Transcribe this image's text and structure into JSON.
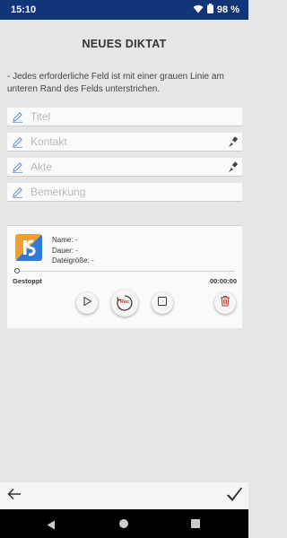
{
  "status": {
    "time": "15:10",
    "battery": "98 %"
  },
  "page": {
    "title": "NEUES DIKTAT",
    "hint": "- Jedes erforderliche Feld ist mit einer grauen Linie am unteren Rand des Felds unterstrichen."
  },
  "fields": [
    {
      "placeholder": "Titel"
    },
    {
      "placeholder": "Kontakt"
    },
    {
      "placeholder": "Akte"
    },
    {
      "placeholder": "Bemerkung"
    }
  ],
  "recording": {
    "name": "Name: -",
    "duration": "Dauer: -",
    "filesize": "Dateigröße: -",
    "state": "Gestoppt",
    "time": "00:00:00",
    "progress": 0,
    "rec_label": "Rec"
  },
  "colors": {
    "statusbar": "#12357a",
    "rec_red": "#c62828",
    "logo_orange": "#f0a030",
    "logo_blue": "#2d7bd6"
  }
}
